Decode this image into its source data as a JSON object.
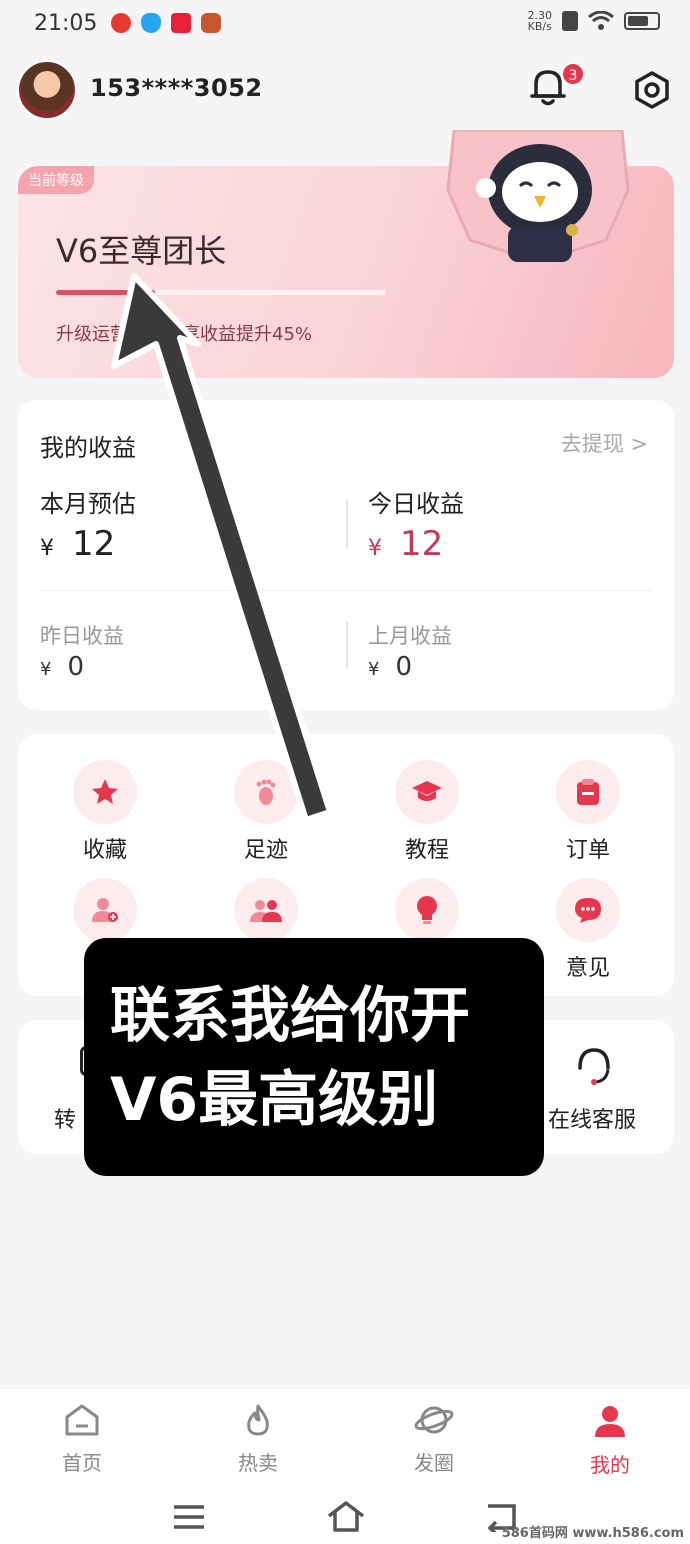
{
  "status_bar": {
    "time": "21:05",
    "net_speed_value": "2.30",
    "net_speed_unit": "KB/s"
  },
  "header": {
    "phone": "153****3052",
    "notification_count": "3"
  },
  "level": {
    "tag": "当前等级",
    "name": "V6至尊团长",
    "description": "升级运营…购分享收益提升45%",
    "progress": 0.3
  },
  "earnings": {
    "title": "我的收益",
    "withdraw": "去提现 >",
    "month_label": "本月预估",
    "month_value": "12",
    "today_label": "今日收益",
    "today_value": "12",
    "yesterday_label": "昨日收益",
    "yesterday_value": "0",
    "last_month_label": "上月收益",
    "last_month_value": "0",
    "currency": "¥"
  },
  "menu": {
    "items": [
      {
        "label": "收藏",
        "icon": "star-icon"
      },
      {
        "label": "足迹",
        "icon": "footprint-icon"
      },
      {
        "label": "教程",
        "icon": "graduation-cap-icon"
      },
      {
        "label": "订单",
        "icon": "clipboard-icon"
      },
      {
        "label": "",
        "icon": "add-user-icon"
      },
      {
        "label": "",
        "icon": "team-icon"
      },
      {
        "label": "",
        "icon": "lightbulb-icon"
      },
      {
        "label": "意见",
        "icon": "chat-bubble-icon"
      }
    ]
  },
  "services": {
    "left_label": "转",
    "right_label": "在线客服"
  },
  "overlay": {
    "line1": "联系我给你开",
    "line2": "V6最高级别"
  },
  "tabs": [
    {
      "label": "首页",
      "icon": "home-icon"
    },
    {
      "label": "热卖",
      "icon": "flame-icon"
    },
    {
      "label": "发圈",
      "icon": "planet-icon"
    },
    {
      "label": "我的",
      "icon": "user-icon"
    }
  ],
  "watermark": "586首码网 www.h586.com",
  "colors": {
    "accent": "#e5384f",
    "card_pink": "#fad3d7"
  }
}
